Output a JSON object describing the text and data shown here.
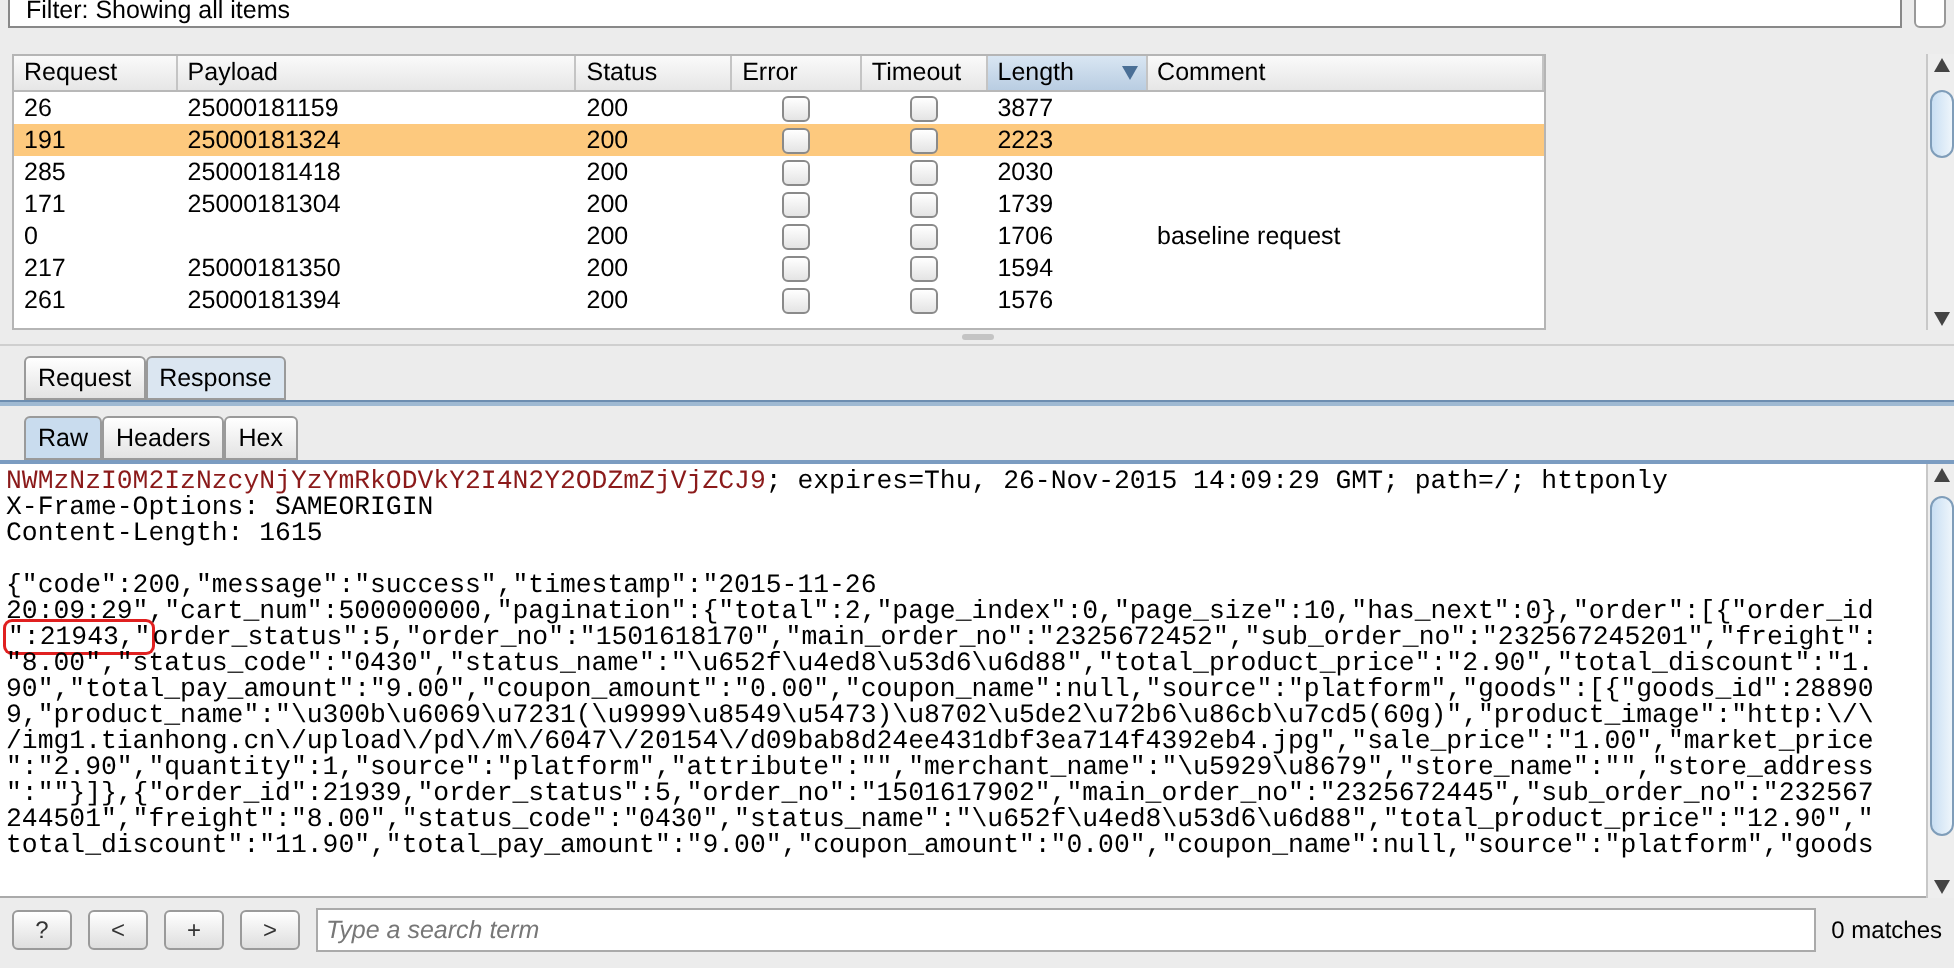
{
  "filter": {
    "text": "Filter: Showing all items"
  },
  "table": {
    "columns": [
      {
        "label": "Request",
        "sorted": false
      },
      {
        "label": "Payload",
        "sorted": false
      },
      {
        "label": "Status",
        "sorted": false
      },
      {
        "label": "Error",
        "sorted": false
      },
      {
        "label": "Timeout",
        "sorted": false
      },
      {
        "label": "Length",
        "sorted": true
      },
      {
        "label": "Comment",
        "sorted": false
      }
    ],
    "rows": [
      {
        "request": "26",
        "payload": "25000181159",
        "status": "200",
        "error": false,
        "timeout": false,
        "length": "3877",
        "selected": false
      },
      {
        "request": "191",
        "payload": "25000181324",
        "status": "200",
        "error": false,
        "timeout": false,
        "length": "2223",
        "selected": true
      },
      {
        "request": "285",
        "payload": "25000181418",
        "status": "200",
        "error": false,
        "timeout": false,
        "length": "2030",
        "selected": false
      },
      {
        "request": "171",
        "payload": "25000181304",
        "status": "200",
        "error": false,
        "timeout": false,
        "length": "1739",
        "selected": false
      },
      {
        "request": "0",
        "status": "200",
        "error": false,
        "timeout": false,
        "length": "1706",
        "comment": "baseline request",
        "selected": false
      },
      {
        "request": "217",
        "payload": "25000181350",
        "status": "200",
        "error": false,
        "timeout": false,
        "length": "1594",
        "selected": false
      },
      {
        "request": "261",
        "payload": "25000181394",
        "status": "200",
        "error": false,
        "timeout": false,
        "length": "1576",
        "selected": false
      }
    ]
  },
  "message_tabs": [
    {
      "label": "Request",
      "selected": false
    },
    {
      "label": "Response",
      "selected": true
    }
  ],
  "view_tabs": [
    {
      "label": "Raw",
      "selected": true
    },
    {
      "label": "Headers",
      "selected": false
    },
    {
      "label": "Hex",
      "selected": false
    }
  ],
  "cookie_line": {
    "value": "NWMzNzI0M2IzNzcyNjYzYmRkODVkY2I4N2Y2ODZmZjVjZCJ9",
    "text": "; expires=Thu, 26-Nov-2015 14:09:29 GMT; path=/; httponly"
  },
  "header_lines": [
    "X-Frame-Options: SAMEORIGIN",
    "Content-Length: 1615"
  ],
  "body_lines": [
    {
      "kind": "plain",
      "text": "{\"code\":200,\"message\":\"success\",\"timestamp\":\"2015-11-26"
    },
    {
      "kind": "plain",
      "text": "20:09:29\",\"cart_num\":500000000,\"pagination\":{\"total\":2,\"page_index\":0,\"page_size\":10,\"has_next\":0},\"order\":[{\"order_id"
    },
    {
      "kind": "boxed",
      "boxed": "\":21943,\"",
      "text": "order_status\":5,\"order_no\":\"1501618170\",\"main_order_no\":\"2325672452\",\"sub_order_no\":\"232567245201\",\"freight\":"
    },
    {
      "kind": "plain",
      "text": "\"8.00\",\"status_code\":\"0430\",\"status_name\":\"\\u652f\\u4ed8\\u53d6\\u6d88\",\"total_product_price\":\"2.90\",\"total_discount\":\"1."
    },
    {
      "kind": "plain",
      "text": "90\",\"total_pay_amount\":\"9.00\",\"coupon_amount\":\"0.00\",\"coupon_name\":null,\"source\":\"platform\",\"goods\":[{\"goods_id\":28890"
    },
    {
      "kind": "plain",
      "text": "9,\"product_name\":\"\\u300b\\u6069\\u7231(\\u9999\\u8549\\u5473)\\u8702\\u5de2\\u72b6\\u86cb\\u7cd5(60g)\",\"product_image\":\"http:\\/\\"
    },
    {
      "kind": "plain",
      "text": "/img1.tianhong.cn\\/upload\\/pd\\/m\\/6047\\/20154\\/d09bab8d24ee431dbf3ea714f4392eb4.jpg\",\"sale_price\":\"1.00\",\"market_price"
    },
    {
      "kind": "plain",
      "text": "\":\"2.90\",\"quantity\":1,\"source\":\"platform\",\"attribute\":\"\",\"merchant_name\":\"\\u5929\\u8679\",\"store_name\":\"\",\"store_address"
    },
    {
      "kind": "plain",
      "text": "\":\"\"}]},{\"order_id\":21939,\"order_status\":5,\"order_no\":\"1501617902\",\"main_order_no\":\"2325672445\",\"sub_order_no\":\"232567"
    },
    {
      "kind": "plain",
      "text": "244501\",\"freight\":\"8.00\",\"status_code\":\"0430\",\"status_name\":\"\\u652f\\u4ed8\\u53d6\\u6d88\",\"total_product_price\":\"12.90\",\""
    },
    {
      "kind": "plain",
      "text": "total_discount\":\"11.90\",\"total_pay_amount\":\"9.00\",\"coupon_amount\":\"0.00\",\"coupon_name\":null,\"source\":\"platform\",\"goods"
    }
  ],
  "search": {
    "buttons": [
      "?",
      "<",
      "+",
      ">"
    ],
    "placeholder": "Type a search term",
    "matches": "0 matches"
  }
}
